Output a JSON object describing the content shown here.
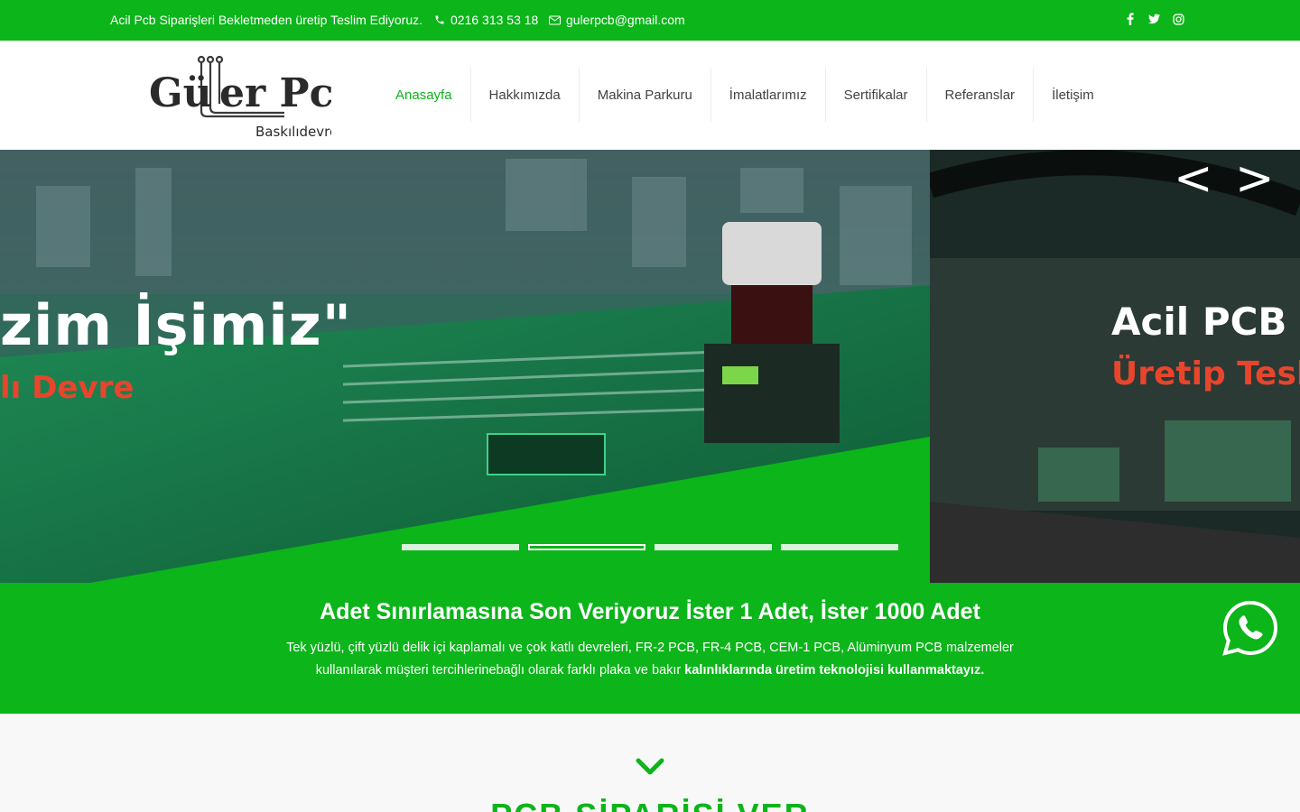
{
  "topbar": {
    "slogan": "Acil Pcb Siparişleri Bekletmeden üretip Teslim Ediyoruz.",
    "phone": "0216 313 53 18",
    "email": "gulerpcb@gmail.com",
    "socials": [
      "facebook-icon",
      "twitter-icon",
      "instagram-icon"
    ]
  },
  "logo": {
    "main": "Güler Pcb",
    "sub": "Baskılıdevre"
  },
  "nav": {
    "items": [
      {
        "label": "Anasayfa",
        "active": true
      },
      {
        "label": "Hakkımızda"
      },
      {
        "label": "Makina Parkuru"
      },
      {
        "label": "İmalatlarımız"
      },
      {
        "label": "Sertifikalar"
      },
      {
        "label": "Referanslar"
      },
      {
        "label": "İletişim"
      }
    ]
  },
  "slider": {
    "slide1_line1": "zim İşimiz\"",
    "slide1_line2": "lı Devre",
    "slide2_line1": "Acil PCB S",
    "slide2_line2": "Üretip Tesli",
    "prev": "<",
    "next": ">",
    "active_index": 1,
    "count": 4
  },
  "banner": {
    "title": "Adet Sınırlamasına Son Veriyoruz İster 1 Adet, İster 1000 Adet",
    "text": "Tek yüzlü, çift yüzlü delik içi kaplamalı ve çok katlı devreleri, FR-2 PCB, FR-4 PCB, CEM-1 PCB, Alüminyum PCB malzemeler kullanılarak müşteri tercihlerinebağlı olarak farklı plaka ve bakır ",
    "bold": "kalınlıklarında üretim teknolojisi kullanmaktayız."
  },
  "section": {
    "heading": "PCB SİPARİŞİ VER"
  },
  "colors": {
    "brand_green": "#0cb51a",
    "accent_red": "#e8452c",
    "dark": "#2d2d2d"
  }
}
